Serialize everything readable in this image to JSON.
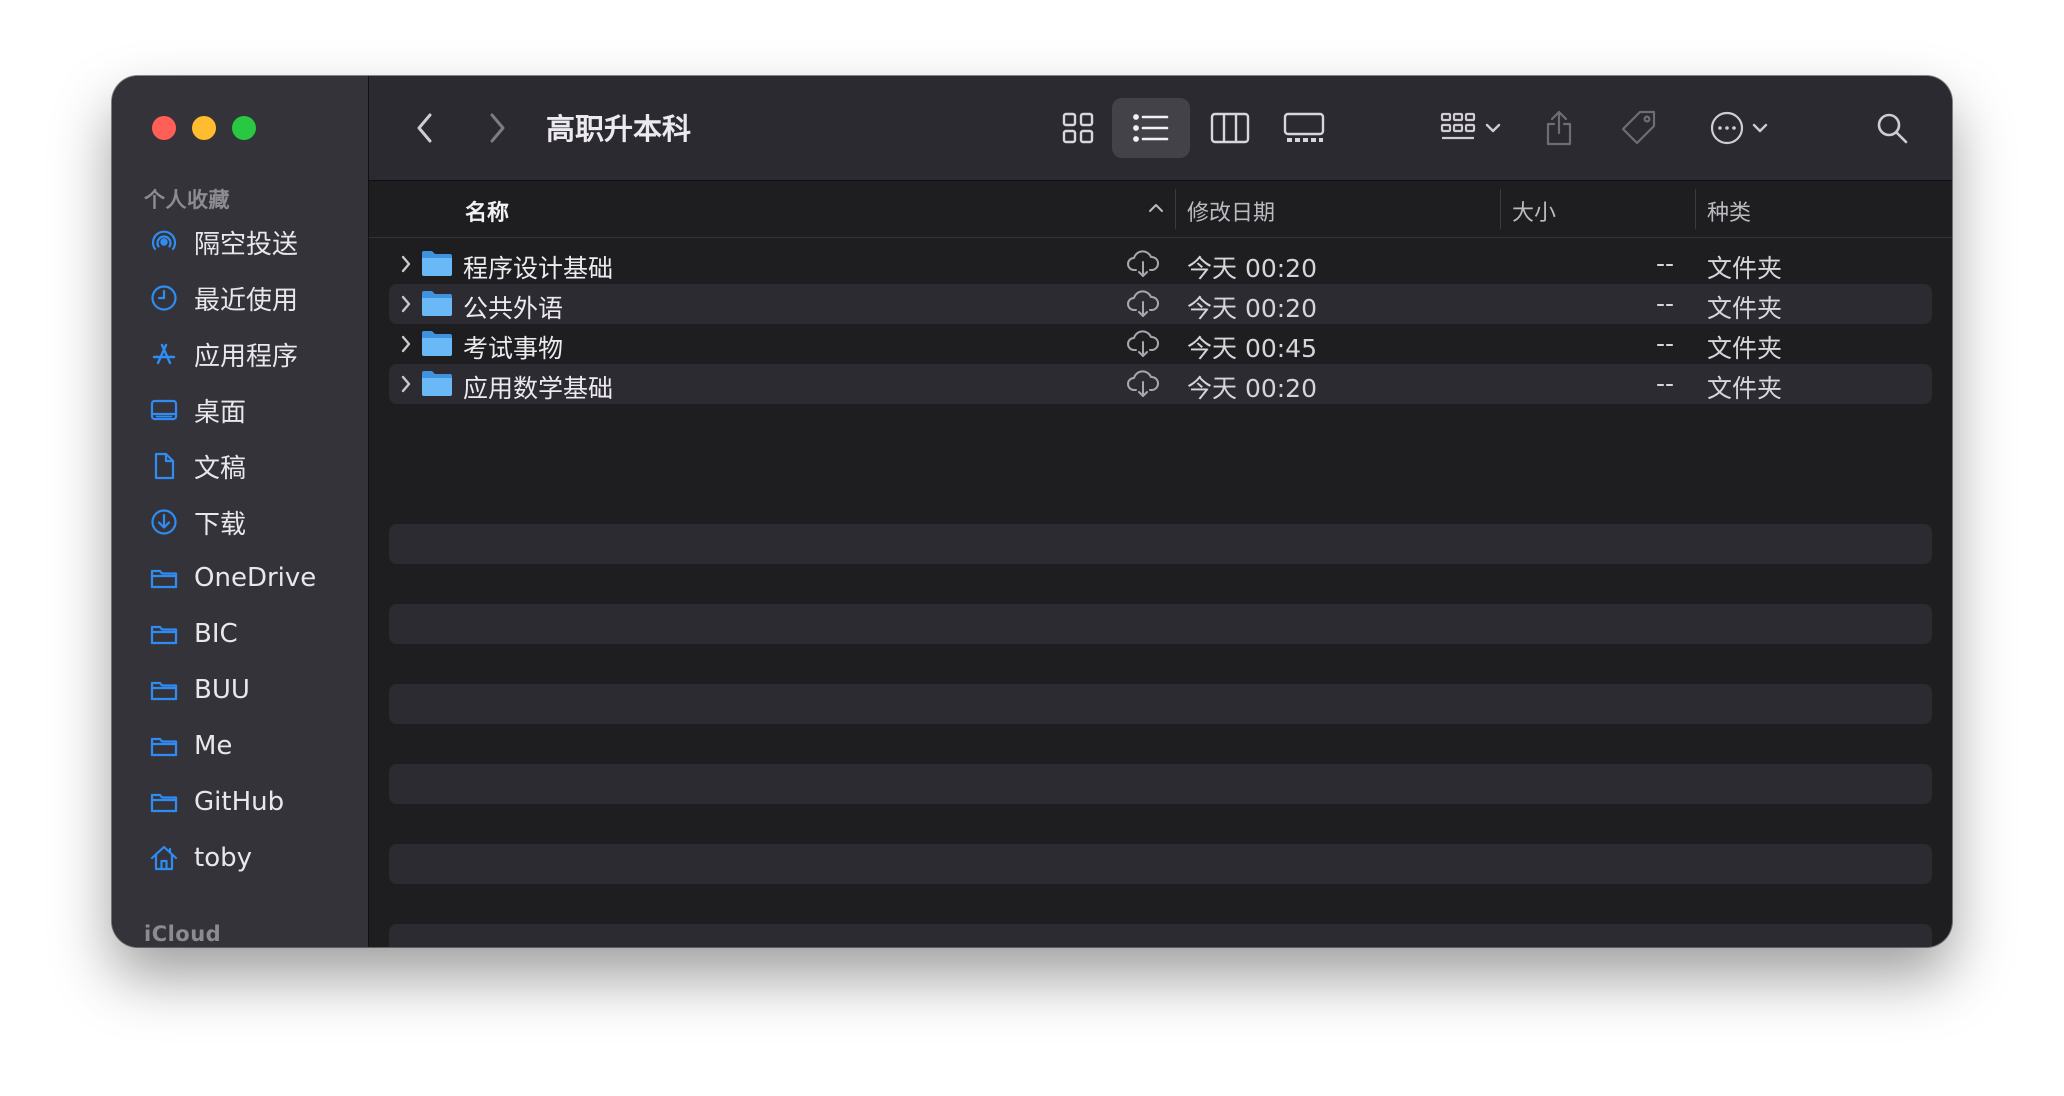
{
  "window": {
    "title": "高职升本科"
  },
  "sidebar": {
    "favorites_label": "个人收藏",
    "icloud_label": "iCloud",
    "items": [
      {
        "label": "隔空投送",
        "icon": "airdrop-icon"
      },
      {
        "label": "最近使用",
        "icon": "clock-icon"
      },
      {
        "label": "应用程序",
        "icon": "applications-icon"
      },
      {
        "label": "桌面",
        "icon": "desktop-icon"
      },
      {
        "label": "文稿",
        "icon": "document-icon"
      },
      {
        "label": "下载",
        "icon": "download-icon"
      },
      {
        "label": "OneDrive",
        "icon": "folder-icon"
      },
      {
        "label": "BIC",
        "icon": "folder-icon"
      },
      {
        "label": "BUU",
        "icon": "folder-icon"
      },
      {
        "label": "Me",
        "icon": "folder-icon"
      },
      {
        "label": "GitHub",
        "icon": "folder-icon"
      },
      {
        "label": "toby",
        "icon": "home-icon"
      }
    ]
  },
  "columns": {
    "name": "名称",
    "date": "修改日期",
    "size": "大小",
    "kind": "种类"
  },
  "files": [
    {
      "name": "程序设计基础",
      "date": "今天 00:20",
      "size": "--",
      "kind": "文件夹"
    },
    {
      "name": "公共外语",
      "date": "今天 00:20",
      "size": "--",
      "kind": "文件夹"
    },
    {
      "name": "考试事物",
      "date": "今天 00:45",
      "size": "--",
      "kind": "文件夹"
    },
    {
      "name": "应用数学基础",
      "date": "今天 00:20",
      "size": "--",
      "kind": "文件夹"
    }
  ],
  "colors": {
    "accent": "#2f8cf2",
    "folder": "#5eb0f5",
    "sidebar_bg": "#35333a",
    "content_bg": "#1e1e20"
  }
}
